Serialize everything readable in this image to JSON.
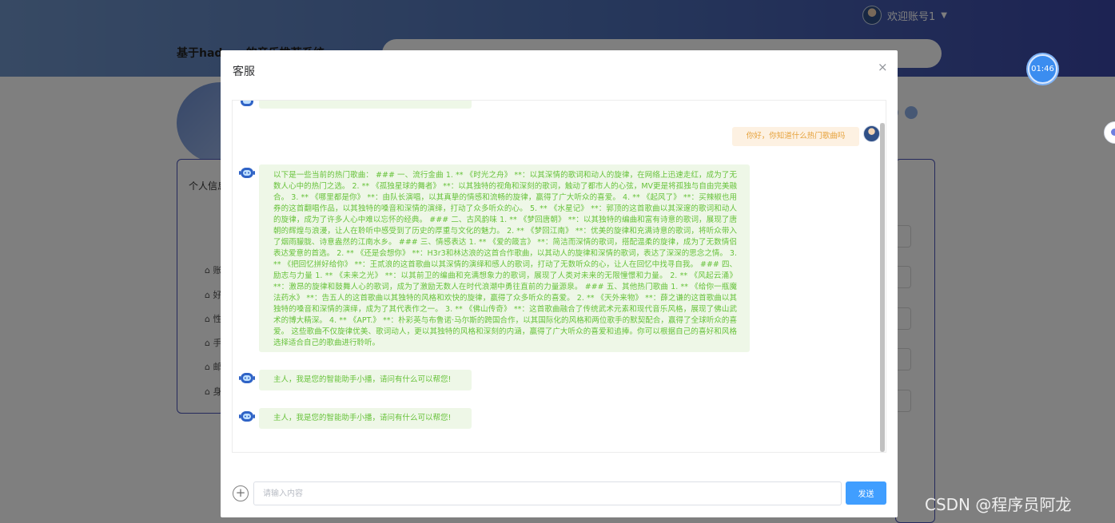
{
  "header": {
    "site_title": "基于hadoop的音乐推荐系统",
    "user_greeting": "欢迎账号1",
    "timer": "01:46"
  },
  "profile": {
    "title": "个人信息",
    "menu": [
      "账",
      "好",
      "性",
      "手",
      "邮",
      "身"
    ]
  },
  "dialog": {
    "title": "客服",
    "close_label": "×",
    "messages": {
      "user_question": "你好，你知道什么热门歌曲吗",
      "bot_answer": "以下是一些当前的热门歌曲： ### 一、流行金曲 1. ** 《时光之舟》 **：以其深情的歌词和动人的旋律，在网络上迅速走红，成为了无数人心中的热门之选。 2. ** 《孤独星球的舞者》 **：以其独特的视角和深刻的歌词，触动了都市人的心弦，MV更是将孤独与自由完美融合。 3. ** 《哪里都是你》 **：由队长演唱，以其真挚的情感和流畅的旋律，赢得了广大听众的喜爱。 4. ** 《起风了》 **：买辣椒也用券的这首翻唱作品，以其独特的嗓音和深情的演绎，打动了众多听众的心。 5. ** 《水星记》 **：郭顶的这首歌曲以其深邃的歌词和动人的旋律，成为了许多人心中难以忘怀的经典。 ### 二、古风韵味 1. ** 《梦回唐朝》 **：以其独特的编曲和富有诗意的歌词，展现了唐朝的辉煌与浪漫，让人在聆听中感受到了历史的厚重与文化的魅力。 2. ** 《梦回江南》 **：优美的旋律和充满诗意的歌词，将听众带入了烟雨朦胧、诗意盎然的江南水乡。 ### 三、情感表达 1. ** 《爱的箴言》 **：简洁而深情的歌词，搭配温柔的旋律，成为了无数情侣表达爱意的首选。 2. ** 《还是会想你》 **：H3r3和林达浪的这首合作歌曲，以其动人的旋律和深情的歌词，表达了深深的思念之情。 3. ** 《把回忆拼好给你》 **：王贰浪的这首歌曲以其深情的演绎和感人的歌词，打动了无数听众的心，让人在回忆中找寻自我。 ### 四、励志与力量 1. ** 《未来之光》 **：以其前卫的编曲和充满想象力的歌词，展现了人类对未来的无限憧憬和力量。 2. ** 《风起云涌》 **：激昂的旋律和鼓舞人心的歌词，成为了激励无数人在时代浪潮中勇往直前的力量源泉。 ### 五、其他热门歌曲 1. ** 《给你一瓶魔法药水》 **：告五人的这首歌曲以其独特的风格和欢快的旋律，赢得了众多听众的喜爱。 2. ** 《天外来物》 **：薛之谦的这首歌曲以其独特的嗓音和深情的演绎，成为了其代表作之一。 3. ** 《佛山传奇》 **：这首歌曲融合了传统武术元素和现代音乐风格，展现了佛山武术的博大精深。 4. ** 《APT.》 **：朴彩英与布鲁诺·马尔斯的跨国合作，以其国际化的风格和两位歌手的默契配合，赢得了全球听众的喜爱。 这些歌曲不仅旋律优美、歌词动人，更以其独特的风格和深刻的内涵，赢得了广大听众的喜爱和追捧。你可以根据自己的喜好和风格选择适合自己的歌曲进行聆听。",
      "bot_greeting_1": "主人，我是您的智能助手小播，请问有什么可以帮您!",
      "bot_greeting_2": "主人，我是您的智能助手小播，请问有什么可以帮您!"
    },
    "input": {
      "placeholder": "请输入内容",
      "value": ""
    },
    "send_label": "发送"
  },
  "watermark": "CSDN @程序员阿龙",
  "colors": {
    "bot_bubble_bg": "#eef7e7",
    "bot_text": "#67c23a",
    "user_bubble_bg": "#fdf1e2",
    "user_text": "#e6a23c",
    "primary": "#409eff"
  },
  "icons": [
    "user-avatar-icon",
    "caret-down-icon",
    "close-icon",
    "robot-icon",
    "plus-circle-icon"
  ]
}
